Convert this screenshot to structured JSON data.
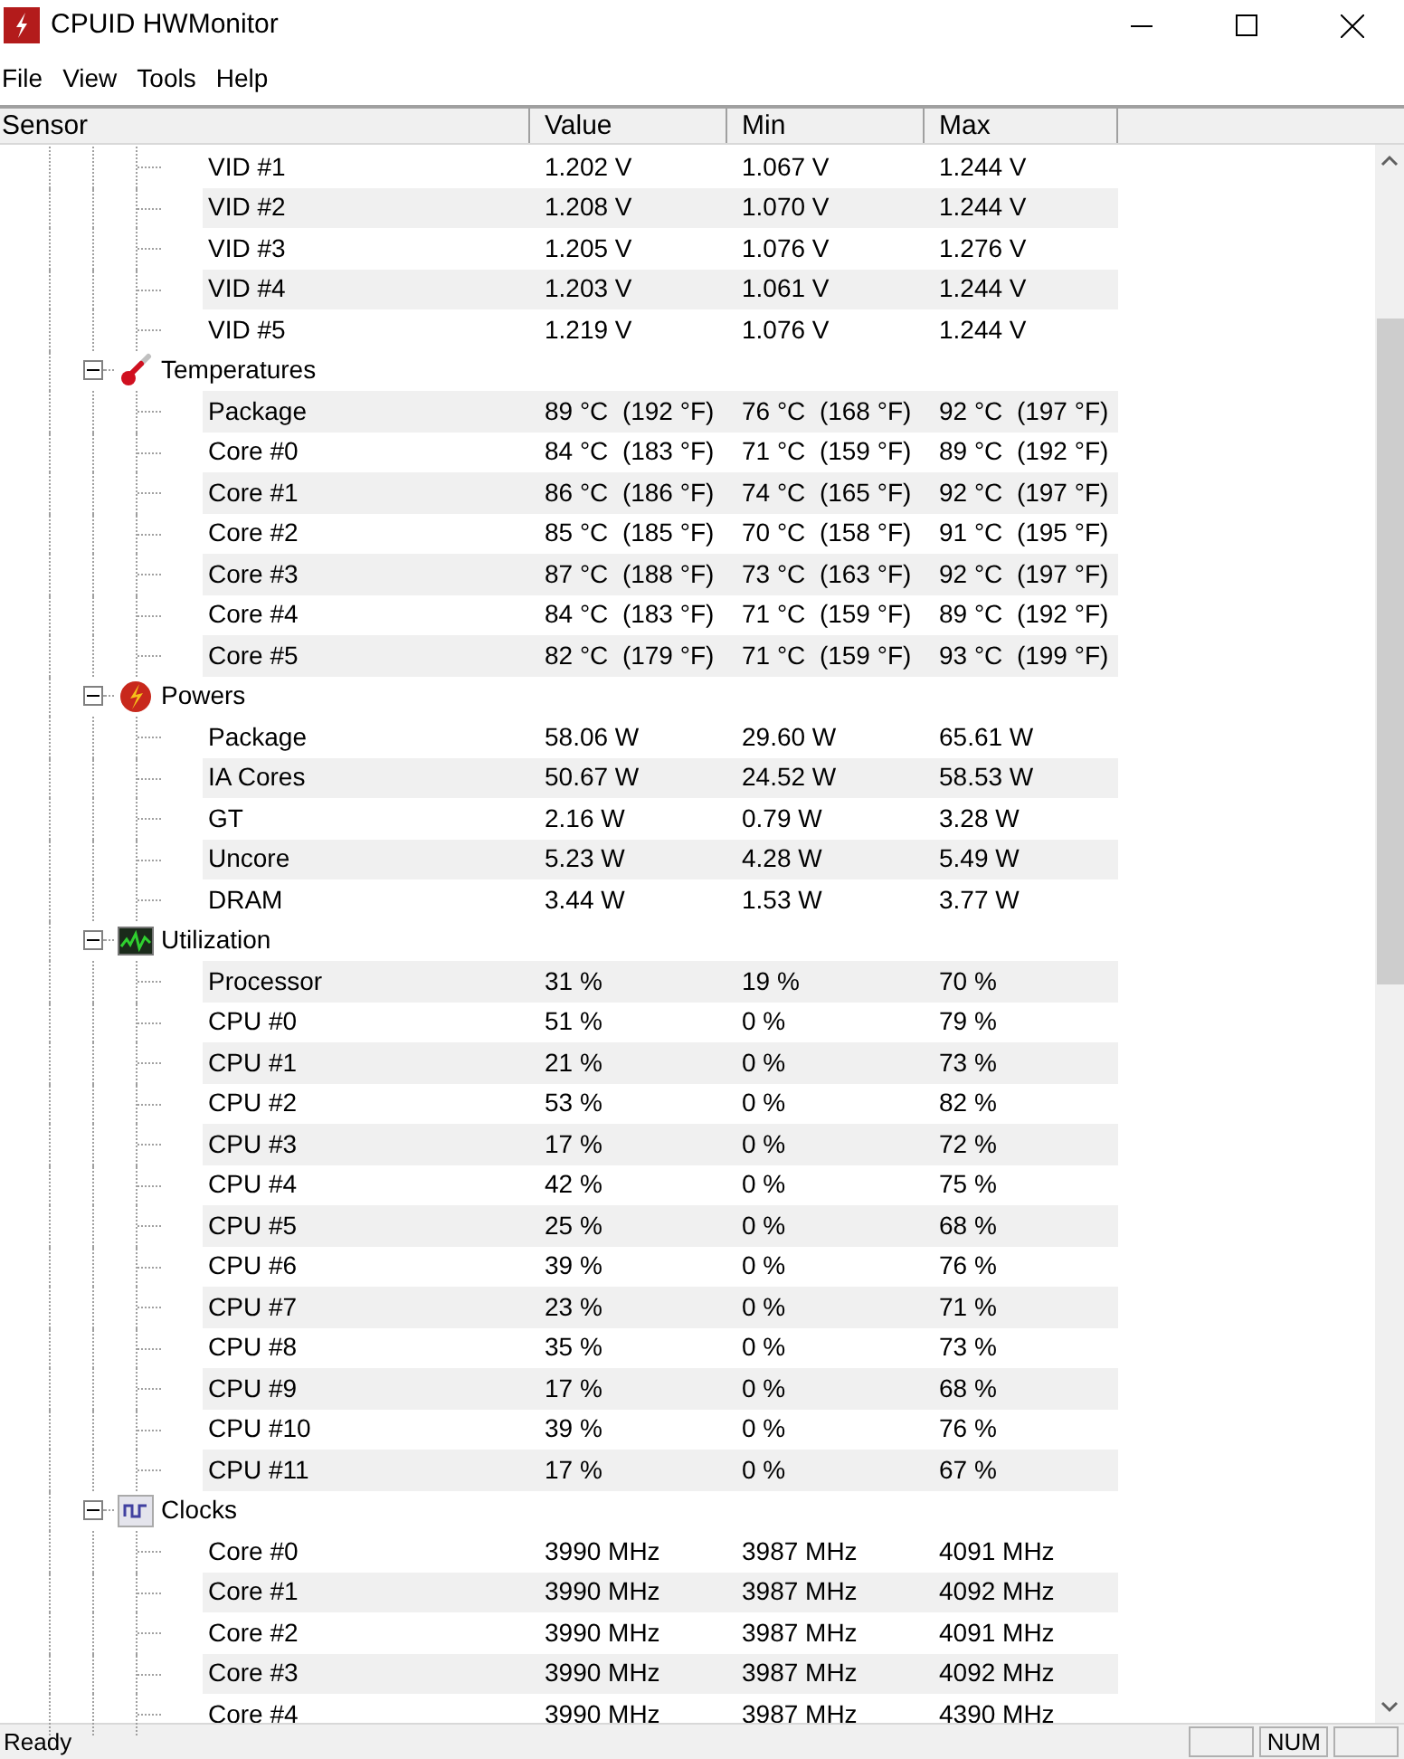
{
  "window": {
    "title": "CPUID HWMonitor"
  },
  "menu": [
    "File",
    "View",
    "Tools",
    "Help"
  ],
  "columns": [
    "Sensor",
    "Value",
    "Min",
    "Max"
  ],
  "groups": [
    {
      "rows": [
        [
          "VID #1",
          "1.202 V",
          "1.067 V",
          "1.244 V"
        ],
        [
          "VID #2",
          "1.208 V",
          "1.070 V",
          "1.244 V"
        ],
        [
          "VID #3",
          "1.205 V",
          "1.076 V",
          "1.276 V"
        ],
        [
          "VID #4",
          "1.203 V",
          "1.061 V",
          "1.244 V"
        ],
        [
          "VID #5",
          "1.219 V",
          "1.076 V",
          "1.244 V"
        ]
      ]
    },
    {
      "label": "Temperatures",
      "kind": "temperature",
      "expanded": true,
      "rows": [
        [
          "Package",
          "89 °C  (192 °F)",
          "76 °C  (168 °F)",
          "92 °C  (197 °F)"
        ],
        [
          "Core #0",
          "84 °C  (183 °F)",
          "71 °C  (159 °F)",
          "89 °C  (192 °F)"
        ],
        [
          "Core #1",
          "86 °C  (186 °F)",
          "74 °C  (165 °F)",
          "92 °C  (197 °F)"
        ],
        [
          "Core #2",
          "85 °C  (185 °F)",
          "70 °C  (158 °F)",
          "91 °C  (195 °F)"
        ],
        [
          "Core #3",
          "87 °C  (188 °F)",
          "73 °C  (163 °F)",
          "92 °C  (197 °F)"
        ],
        [
          "Core #4",
          "84 °C  (183 °F)",
          "71 °C  (159 °F)",
          "89 °C  (192 °F)"
        ],
        [
          "Core #5",
          "82 °C  (179 °F)",
          "71 °C  (159 °F)",
          "93 °C  (199 °F)"
        ]
      ]
    },
    {
      "label": "Powers",
      "kind": "power",
      "expanded": true,
      "rows": [
        [
          "Package",
          "58.06 W",
          "29.60 W",
          "65.61 W"
        ],
        [
          "IA Cores",
          "50.67 W",
          "24.52 W",
          "58.53 W"
        ],
        [
          "GT",
          "2.16 W",
          "0.79 W",
          "3.28 W"
        ],
        [
          "Uncore",
          "5.23 W",
          "4.28 W",
          "5.49 W"
        ],
        [
          "DRAM",
          "3.44 W",
          "1.53 W",
          "3.77 W"
        ]
      ]
    },
    {
      "label": "Utilization",
      "kind": "utilization",
      "expanded": true,
      "rows": [
        [
          "Processor",
          "31 %",
          "19 %",
          "70 %"
        ],
        [
          "CPU #0",
          "51 %",
          "0 %",
          "79 %"
        ],
        [
          "CPU #1",
          "21 %",
          "0 %",
          "73 %"
        ],
        [
          "CPU #2",
          "53 %",
          "0 %",
          "82 %"
        ],
        [
          "CPU #3",
          "17 %",
          "0 %",
          "72 %"
        ],
        [
          "CPU #4",
          "42 %",
          "0 %",
          "75 %"
        ],
        [
          "CPU #5",
          "25 %",
          "0 %",
          "68 %"
        ],
        [
          "CPU #6",
          "39 %",
          "0 %",
          "76 %"
        ],
        [
          "CPU #7",
          "23 %",
          "0 %",
          "71 %"
        ],
        [
          "CPU #8",
          "35 %",
          "0 %",
          "73 %"
        ],
        [
          "CPU #9",
          "17 %",
          "0 %",
          "68 %"
        ],
        [
          "CPU #10",
          "39 %",
          "0 %",
          "76 %"
        ],
        [
          "CPU #11",
          "17 %",
          "0 %",
          "67 %"
        ]
      ]
    },
    {
      "label": "Clocks",
      "kind": "clock",
      "expanded": true,
      "rows": [
        [
          "Core #0",
          "3990 MHz",
          "3987 MHz",
          "4091 MHz"
        ],
        [
          "Core #1",
          "3990 MHz",
          "3987 MHz",
          "4092 MHz"
        ],
        [
          "Core #2",
          "3990 MHz",
          "3987 MHz",
          "4091 MHz"
        ],
        [
          "Core #3",
          "3990 MHz",
          "3987 MHz",
          "4092 MHz"
        ],
        [
          "Core #4",
          "3990 MHz",
          "3987 MHz",
          "4390 MHz"
        ]
      ]
    }
  ],
  "status_bar": {
    "text": "Ready",
    "panes": [
      {
        "kind": "blank"
      },
      {
        "kind": "text",
        "text": "NUM"
      },
      {
        "kind": "blank"
      }
    ]
  }
}
